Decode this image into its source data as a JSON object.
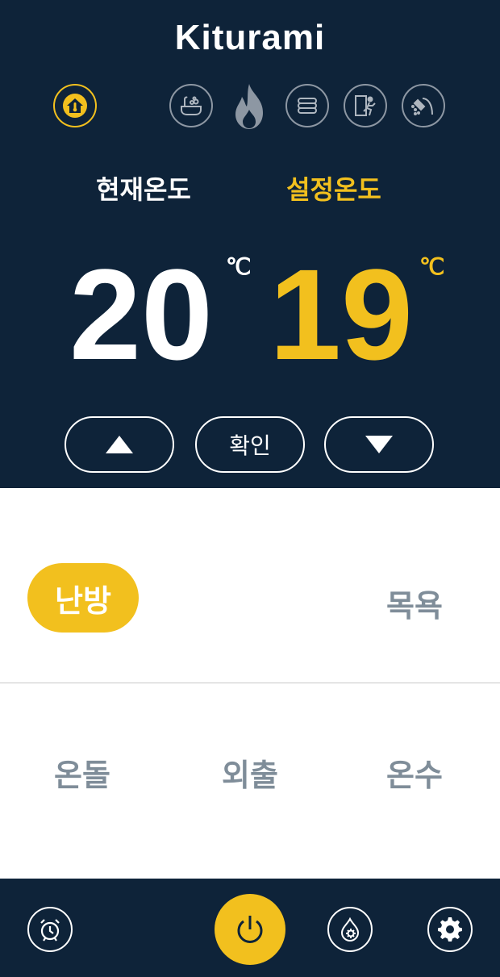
{
  "brand": {
    "logo_text": "Kiturami"
  },
  "mode_icons": [
    {
      "name": "home-heating-icon",
      "active": true
    },
    {
      "name": "bath-icon",
      "active": false
    },
    {
      "name": "flame-icon",
      "active": false
    },
    {
      "name": "floor-heating-icon",
      "active": false
    },
    {
      "name": "away-exit-icon",
      "active": false
    },
    {
      "name": "shower-icon",
      "active": false
    }
  ],
  "temperature": {
    "current_label": "현재온도",
    "set_label": "설정온도",
    "current_value": "20",
    "set_value": "19",
    "unit": "℃"
  },
  "controls": {
    "confirm_label": "확인"
  },
  "modes": {
    "heating": "난방",
    "bath": "목욕",
    "ondol": "온돌",
    "away": "외출",
    "hot_water": "온수"
  },
  "colors": {
    "navy": "#0e2339",
    "accent": "#f2c01e",
    "muted": "#7f8d99"
  }
}
